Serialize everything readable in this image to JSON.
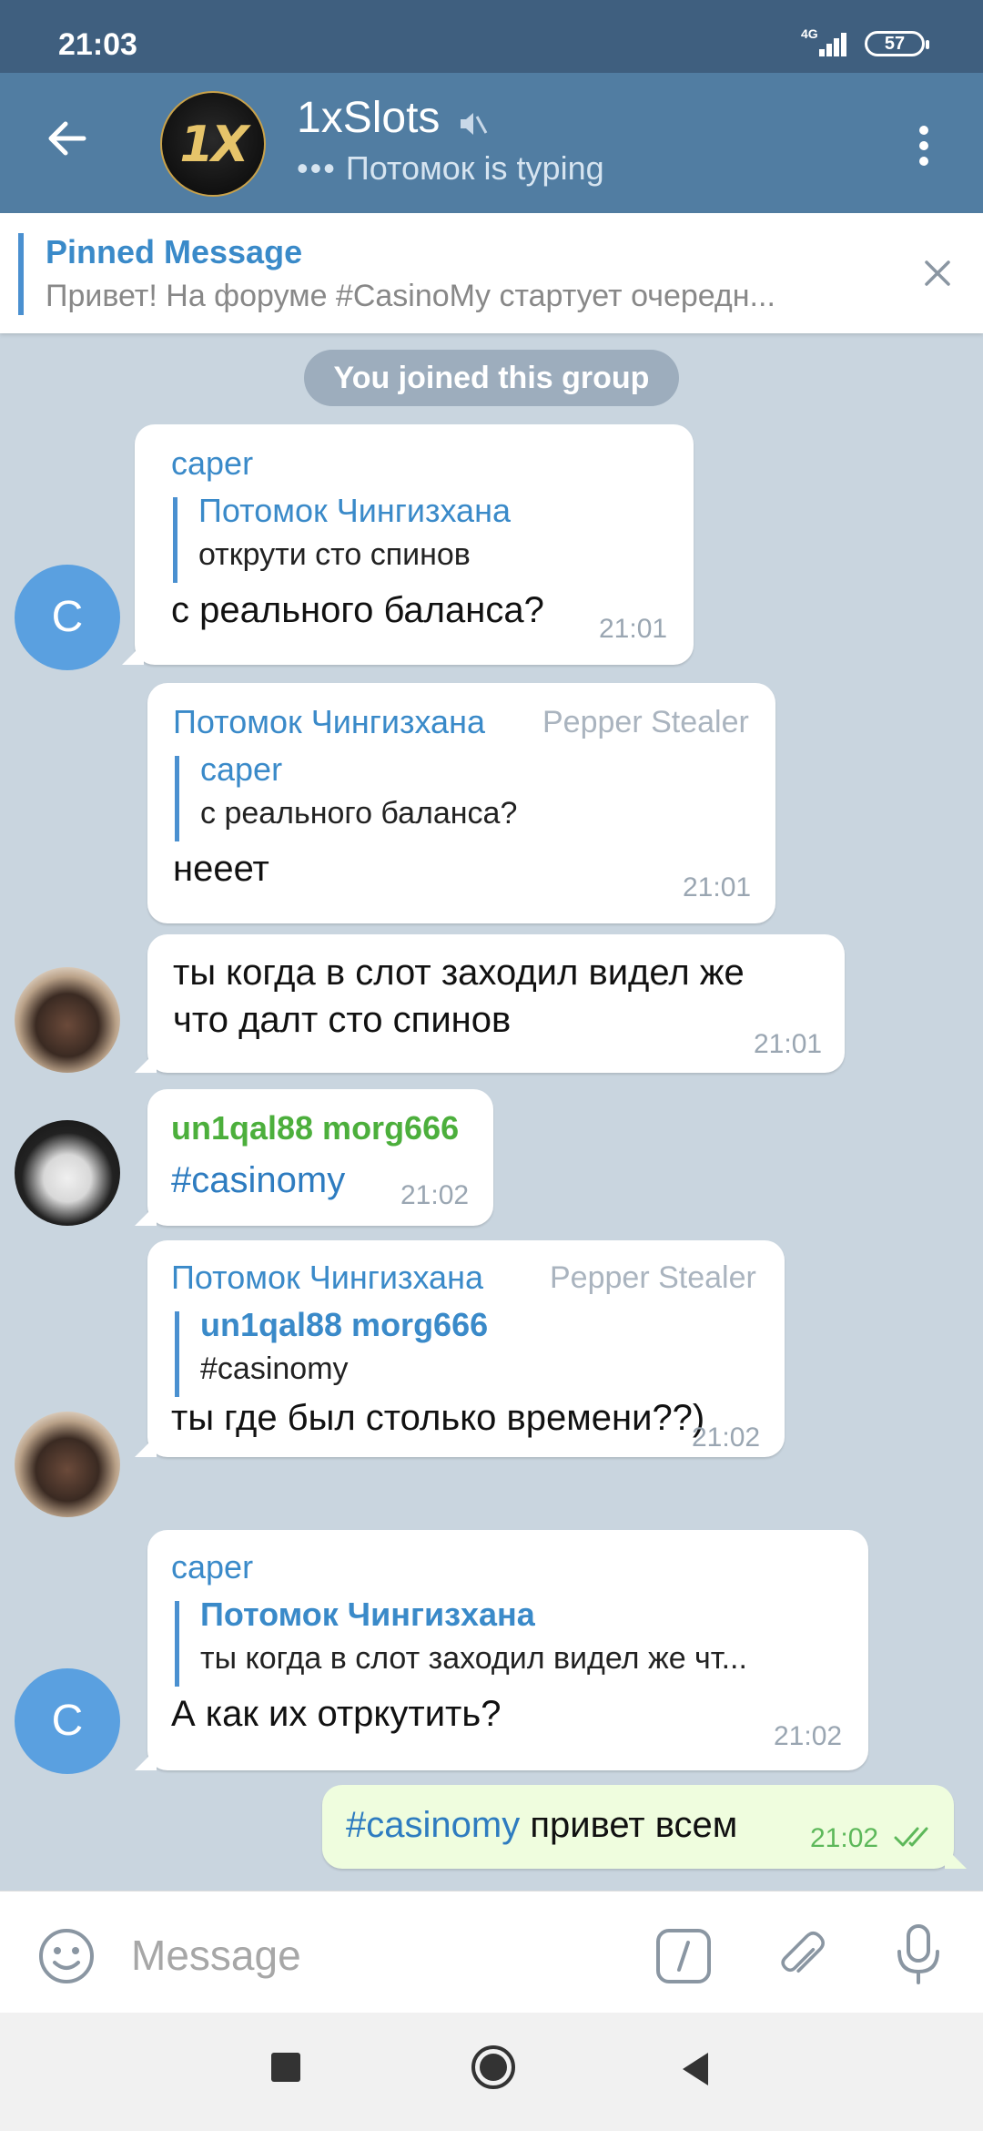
{
  "status_bar": {
    "time": "21:03",
    "network": "4G",
    "battery": "57"
  },
  "header": {
    "avatar_text": "1X",
    "title": "1xSlots",
    "typing_dots": "•••",
    "typing_text": "Потомок is typing",
    "colors": {
      "header_bg": "#517da2",
      "status_bg": "#3f5f7f"
    }
  },
  "pinned": {
    "title": "Pinned Message",
    "text": "Привет! На форуме #CasinoMy стартует очередн..."
  },
  "chat": {
    "service_message": "You joined this group",
    "messages": [
      {
        "author": "caper",
        "author_color": "#3a8ac9",
        "avatar": "C",
        "reply_name": "Потомок Чингизхана",
        "reply_text": "открути сто спинов",
        "text": "с реального баланса?",
        "time": "21:01"
      },
      {
        "author": "Потомок Чингизхана",
        "author_color": "#3a8ac9",
        "role": "Pepper Stealer",
        "reply_name": "caper",
        "reply_text": "с реального баланса?",
        "text": "нееет",
        "time": "21:01"
      },
      {
        "text_line1": "ты когда в слот заходил видел же",
        "text_line2": "что далт сто спинов",
        "time": "21:01"
      },
      {
        "author": "un1qal88 morg666",
        "author_color": "#4caf3c",
        "text": "#casinomy",
        "time": "21:02"
      },
      {
        "author": "Потомок Чингизхана",
        "author_color": "#3a8ac9",
        "role": "Pepper Stealer",
        "reply_name": "un1qal88 morg666",
        "reply_text": "#casinomy",
        "text": "ты где был столько времени??)",
        "time": "21:02"
      },
      {
        "author": "caper",
        "author_color": "#3a8ac9",
        "avatar": "C",
        "reply_name": "Потомок Чингизхана",
        "reply_text": "ты когда в слот заходил видел же чт...",
        "text": "А как их отркутить?",
        "time": "21:02"
      }
    ],
    "outgoing": {
      "hashtag": "#casinomy",
      "text": " привет всем",
      "time": "21:02"
    }
  },
  "input": {
    "placeholder": "Message"
  }
}
